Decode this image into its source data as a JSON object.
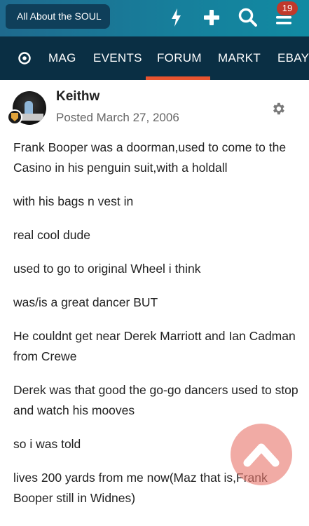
{
  "header": {
    "back_label": "All About the SOUL",
    "notification_count": "19",
    "icons": [
      "lightning-icon",
      "plus-icon",
      "search-icon",
      "menu-icon"
    ]
  },
  "nav": {
    "items": [
      "MAG",
      "EVENTS",
      "FORUM",
      "MARKT",
      "EBAY"
    ],
    "active": "FORUM",
    "home_icon": "target-icon"
  },
  "post": {
    "author": "Keithw",
    "date": "Posted March 27, 2006",
    "paragraphs": [
      "Frank Booper was a doorman,used to come to the Casino in his penguin suit,with a holdall",
      "with his bags n vest in",
      "real cool dude",
      "used to go to original Wheel i think",
      "was/is a great dancer BUT",
      "He couldnt get near Derek Marriott and Ian Cadman from Crewe",
      "Derek was that good the go-go dancers used to stop and watch his mooves",
      "so i was told",
      "lives 200 yards from me now(Maz that is,Frank Booper still in Widnes)"
    ]
  },
  "colors": {
    "topbar": "#1a7596",
    "navbar": "#0a2f44",
    "accent": "#e8542f",
    "badge": "#c0392b"
  }
}
